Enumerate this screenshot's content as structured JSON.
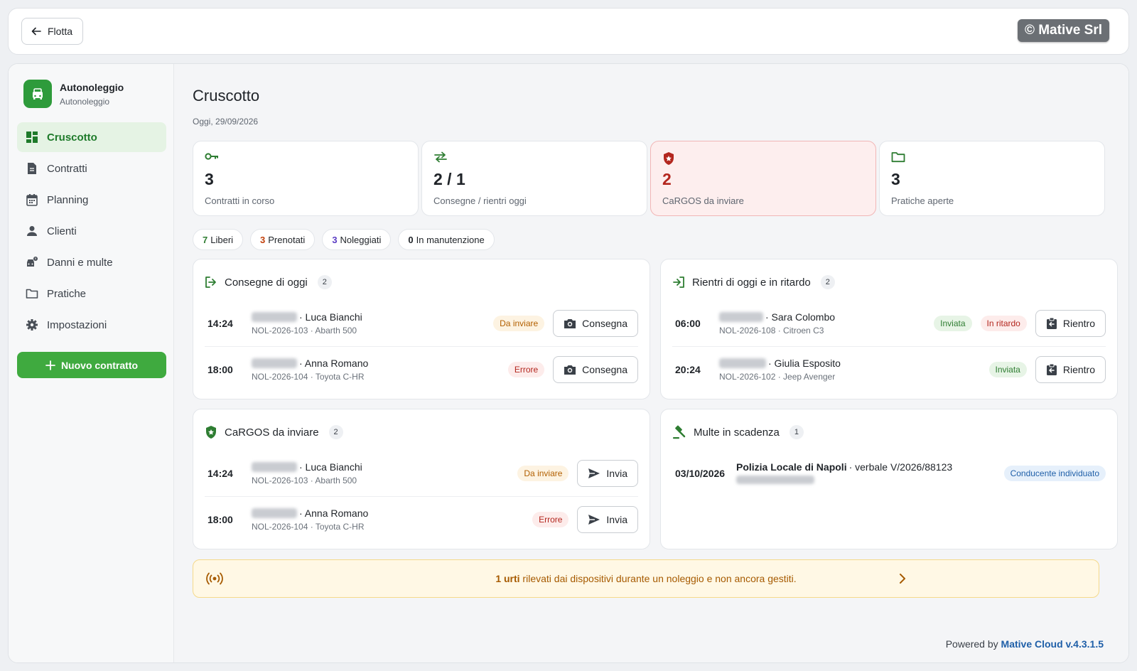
{
  "topbar": {
    "back_label": "Flotta",
    "brand_badge": "© Mative Srl"
  },
  "sidebar": {
    "brand_name": "Autonoleggio",
    "brand_sub": "Autonoleggio",
    "items": [
      {
        "label": "Cruscotto",
        "icon": "dashboard-icon",
        "active": true
      },
      {
        "label": "Contratti",
        "icon": "document-icon"
      },
      {
        "label": "Planning",
        "icon": "calendar-icon"
      },
      {
        "label": "Clienti",
        "icon": "person-icon"
      },
      {
        "label": "Danni e multe",
        "icon": "car-damage-icon"
      },
      {
        "label": "Pratiche",
        "icon": "folder-icon"
      },
      {
        "label": "Impostazioni",
        "icon": "gear-icon"
      }
    ],
    "new_contract_label": "Nuovo contratto"
  },
  "main": {
    "title": "Cruscotto",
    "date": "Oggi, 29/09/2026",
    "stats": [
      {
        "value": "3",
        "label": "Contratti in corso",
        "icon": "key-icon"
      },
      {
        "value": "2 / 1",
        "label": "Consegne / rientri oggi",
        "icon": "swap-icon"
      },
      {
        "value": "2",
        "label": "CaRGOS da inviare",
        "icon": "shield-icon",
        "alert": true
      },
      {
        "value": "3",
        "label": "Pratiche aperte",
        "icon": "folder-icon"
      }
    ],
    "chips": [
      {
        "count": "7",
        "label": "Liberi",
        "color": "#2f7d32"
      },
      {
        "count": "3",
        "label": "Prenotati",
        "color": "#c2410c"
      },
      {
        "count": "3",
        "label": "Noleggiati",
        "color": "#5b3cc4"
      },
      {
        "count": "0",
        "label": "In manutenzione",
        "color": "#1f2328"
      }
    ],
    "deliveries": {
      "title": "Consegne di oggi",
      "count": "2",
      "rows": [
        {
          "time": "14:24",
          "name": "· Luca Bianchi",
          "sub": "NOL-2026-103 · Abarth 500",
          "badge": "Da inviare",
          "action": "Consegna"
        },
        {
          "time": "18:00",
          "name": "· Anna Romano",
          "sub": "NOL-2026-104 · Toyota C-HR",
          "badge": "Errore",
          "action": "Consegna"
        }
      ]
    },
    "returns": {
      "title": "Rientri di oggi e in ritardo",
      "count": "2",
      "rows": [
        {
          "time": "06:00",
          "name": "· Sara Colombo",
          "sub": "NOL-2026-108 · Citroen C3",
          "badge": "Inviata",
          "badge2": "In ritardo",
          "action": "Rientro"
        },
        {
          "time": "20:24",
          "name": "· Giulia Esposito",
          "sub": "NOL-2026-102 · Jeep Avenger",
          "badge": "Inviata",
          "action": "Rientro"
        }
      ]
    },
    "cargos": {
      "title": "CaRGOS da inviare",
      "count": "2",
      "rows": [
        {
          "time": "14:24",
          "name": "· Luca Bianchi",
          "sub": "NOL-2026-103 · Abarth 500",
          "badge": "Da inviare",
          "action": "Invia"
        },
        {
          "time": "18:00",
          "name": "· Anna Romano",
          "sub": "NOL-2026-104 · Toyota C-HR",
          "badge": "Errore",
          "action": "Invia"
        }
      ]
    },
    "fines": {
      "title": "Multe in scadenza",
      "count": "1",
      "rows": [
        {
          "date": "03/10/2026",
          "authority": "Polizia Locale di Napoli",
          "ref": " · verbale V/2026/88123",
          "badge": "Conducente individuato"
        }
      ]
    },
    "alert": {
      "count": "1 urti",
      "text": " rilevati dai dispositivi durante un noleggio e non ancora gestiti."
    }
  },
  "footer": {
    "prefix": "Powered by ",
    "product": "Mative Cloud v.4.3.1.5"
  }
}
